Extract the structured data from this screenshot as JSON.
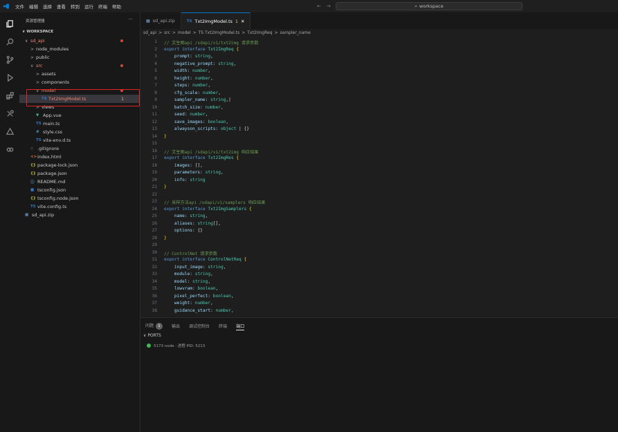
{
  "menu": [
    "文件",
    "编辑",
    "选择",
    "查看",
    "转到",
    "运行",
    "终端",
    "帮助"
  ],
  "command_center": {
    "icon": "search-icon",
    "text": "workspace"
  },
  "sidebar": {
    "title": "资源管理器",
    "section": "WORKSPACE",
    "tree": [
      {
        "label": "sd_api",
        "depth": 0,
        "chev": "∨",
        "mod": "dot",
        "color": "#f48771"
      },
      {
        "label": "node_modules",
        "depth": 1,
        "chev": ">"
      },
      {
        "label": "public",
        "depth": 1,
        "chev": ">"
      },
      {
        "label": "src",
        "depth": 1,
        "chev": "∨",
        "mod": "dot",
        "color": "#f48771"
      },
      {
        "label": "assets",
        "depth": 2,
        "chev": ">"
      },
      {
        "label": "components",
        "depth": 2,
        "chev": ">"
      },
      {
        "label": "model",
        "depth": 2,
        "chev": "∨",
        "mod": "dot",
        "color": "#f48771"
      },
      {
        "label": "Txt2ImgModel.ts",
        "depth": 3,
        "icon": "TS",
        "icolor": "#3178c6",
        "mod": "num",
        "num": "1",
        "color": "#f48771",
        "selected": true
      },
      {
        "label": "views",
        "depth": 2,
        "chev": ">"
      },
      {
        "label": "App.vue",
        "depth": 2,
        "icon": "▼",
        "icolor": "#41b883"
      },
      {
        "label": "main.ts",
        "depth": 2,
        "icon": "TS",
        "icolor": "#3178c6"
      },
      {
        "label": "style.css",
        "depth": 2,
        "icon": "#",
        "icolor": "#519aba"
      },
      {
        "label": "vite-env.d.ts",
        "depth": 2,
        "icon": "TS",
        "icolor": "#3178c6"
      },
      {
        "label": ".gitignore",
        "depth": 1,
        "icon": "◇",
        "icolor": "#6d8086"
      },
      {
        "label": "index.html",
        "depth": 1,
        "icon": "<>",
        "icolor": "#e37933"
      },
      {
        "label": "package-lock.json",
        "depth": 1,
        "icon": "{}",
        "icolor": "#cbcb41"
      },
      {
        "label": "package.json",
        "depth": 1,
        "icon": "{}",
        "icolor": "#cbcb41"
      },
      {
        "label": "README.md",
        "depth": 1,
        "icon": "ⓘ",
        "icolor": "#519aba"
      },
      {
        "label": "tsconfig.json",
        "depth": 1,
        "icon": "■",
        "icolor": "#3178c6"
      },
      {
        "label": "tsconfig.node.json",
        "depth": 1,
        "icon": "{}",
        "icolor": "#cbcb41"
      },
      {
        "label": "vite.config.ts",
        "depth": 1,
        "icon": "TS",
        "icolor": "#3178c6"
      },
      {
        "label": "sd_api.zip",
        "depth": 0,
        "icon": "▦",
        "icolor": "#7ca0d6"
      }
    ]
  },
  "tabs": [
    {
      "label": "sd_api.zip",
      "icon": "zip-icon",
      "active": false
    },
    {
      "label": "Txt2ImgModel.ts",
      "suffix": "1",
      "icon": "ts-icon",
      "active": true,
      "close": "✕"
    }
  ],
  "breadcrumbs": [
    "sd_api",
    ">",
    "src",
    ">",
    "model",
    ">",
    "TS Txt2ImgModel.ts",
    ">",
    "Txt2ImgReq",
    ">",
    "sampler_name"
  ],
  "code_lines": [
    [
      [
        "c",
        "// 文生图api /sdapi/v1/txt2img 请求参数"
      ]
    ],
    [
      [
        "k",
        "export interface "
      ],
      [
        "t",
        "Txt2ImgReq "
      ],
      [
        "b",
        "{"
      ]
    ],
    [
      [
        "v",
        "    prompt"
      ],
      [
        "p",
        ": "
      ],
      [
        "t",
        "string"
      ],
      [
        "p",
        ","
      ]
    ],
    [
      [
        "v",
        "    negative_prompt"
      ],
      [
        "p",
        ": "
      ],
      [
        "t",
        "string"
      ],
      [
        "p",
        ","
      ]
    ],
    [
      [
        "v",
        "    width"
      ],
      [
        "p",
        ": "
      ],
      [
        "t",
        "number"
      ],
      [
        "p",
        ","
      ]
    ],
    [
      [
        "v",
        "    height"
      ],
      [
        "p",
        ": "
      ],
      [
        "t",
        "number"
      ],
      [
        "p",
        ","
      ]
    ],
    [
      [
        "v",
        "    steps"
      ],
      [
        "p",
        ": "
      ],
      [
        "t",
        "number"
      ],
      [
        "p",
        ","
      ]
    ],
    [
      [
        "v",
        "    cfg_scale"
      ],
      [
        "p",
        ": "
      ],
      [
        "t",
        "number"
      ],
      [
        "p",
        ","
      ]
    ],
    [
      [
        "v",
        "    sampler_name"
      ],
      [
        "p",
        ": "
      ],
      [
        "t",
        "string"
      ],
      [
        "p",
        ",|"
      ]
    ],
    [
      [
        "v",
        "    batch_size"
      ],
      [
        "p",
        ": "
      ],
      [
        "t",
        "number"
      ],
      [
        "p",
        ","
      ]
    ],
    [
      [
        "v",
        "    seed"
      ],
      [
        "p",
        ": "
      ],
      [
        "t",
        "number"
      ],
      [
        "p",
        ","
      ]
    ],
    [
      [
        "v",
        "    save_images"
      ],
      [
        "p",
        ": "
      ],
      [
        "t",
        "boolean"
      ],
      [
        "p",
        ","
      ]
    ],
    [
      [
        "v",
        "    alwayson_scripts"
      ],
      [
        "p",
        ": "
      ],
      [
        "t",
        "object"
      ],
      [
        "p",
        " | {}"
      ]
    ],
    [
      [
        "b",
        "}"
      ]
    ],
    [],
    [
      [
        "c",
        "// 文生图api /sdapi/v1/txt2img 响应结果"
      ]
    ],
    [
      [
        "k",
        "export interface "
      ],
      [
        "t",
        "Txt2ImgRes "
      ],
      [
        "b",
        "{"
      ]
    ],
    [
      [
        "v",
        "    images"
      ],
      [
        "p",
        ": [],"
      ]
    ],
    [
      [
        "v",
        "    parameters"
      ],
      [
        "p",
        ": "
      ],
      [
        "t",
        "string"
      ],
      [
        "p",
        ","
      ]
    ],
    [
      [
        "v",
        "    info"
      ],
      [
        "p",
        ": "
      ],
      [
        "t",
        "string"
      ]
    ],
    [
      [
        "b",
        "}"
      ]
    ],
    [],
    [
      [
        "c",
        "// 采样方法api /sdapi/v1/samplers 响应结果"
      ]
    ],
    [
      [
        "k",
        "export interface "
      ],
      [
        "t",
        "Txt2ImgSamplers "
      ],
      [
        "b",
        "{"
      ]
    ],
    [
      [
        "v",
        "    name"
      ],
      [
        "p",
        ": "
      ],
      [
        "t",
        "string"
      ],
      [
        "p",
        ","
      ]
    ],
    [
      [
        "v",
        "    aliases"
      ],
      [
        "p",
        ": "
      ],
      [
        "t",
        "string"
      ],
      [
        "p",
        "[],"
      ]
    ],
    [
      [
        "v",
        "    options"
      ],
      [
        "p",
        ": {}"
      ]
    ],
    [
      [
        "b",
        "}"
      ]
    ],
    [],
    [
      [
        "c",
        "// ControlNet 请求参数"
      ]
    ],
    [
      [
        "k",
        "export interface "
      ],
      [
        "t",
        "ControlNetReq "
      ],
      [
        "b",
        "{"
      ]
    ],
    [
      [
        "v",
        "    input_image"
      ],
      [
        "p",
        ": "
      ],
      [
        "t",
        "string"
      ],
      [
        "p",
        ","
      ]
    ],
    [
      [
        "v",
        "    module"
      ],
      [
        "p",
        ": "
      ],
      [
        "t",
        "string"
      ],
      [
        "p",
        ","
      ]
    ],
    [
      [
        "v",
        "    model"
      ],
      [
        "p",
        ": "
      ],
      [
        "t",
        "string"
      ],
      [
        "p",
        ","
      ]
    ],
    [
      [
        "v",
        "    lowvram"
      ],
      [
        "p",
        ": "
      ],
      [
        "t",
        "boolean"
      ],
      [
        "p",
        ","
      ]
    ],
    [
      [
        "v",
        "    pixel_perfect"
      ],
      [
        "p",
        ": "
      ],
      [
        "t",
        "boolean"
      ],
      [
        "p",
        ","
      ]
    ],
    [
      [
        "v",
        "    weight"
      ],
      [
        "p",
        ": "
      ],
      [
        "t",
        "number"
      ],
      [
        "p",
        ","
      ]
    ],
    [
      [
        "v",
        "    guidance_start"
      ],
      [
        "p",
        ": "
      ],
      [
        "t",
        "number"
      ],
      [
        "p",
        ","
      ]
    ]
  ],
  "panel": {
    "tabs": [
      {
        "label": "问题",
        "badge": "1"
      },
      {
        "label": "输出"
      },
      {
        "label": "调试控制台"
      },
      {
        "label": "终端"
      },
      {
        "label": "端口",
        "active": true
      }
    ],
    "ports_title": "PORTS",
    "ports_row": "5173 node · 进程 PID: 5213"
  }
}
